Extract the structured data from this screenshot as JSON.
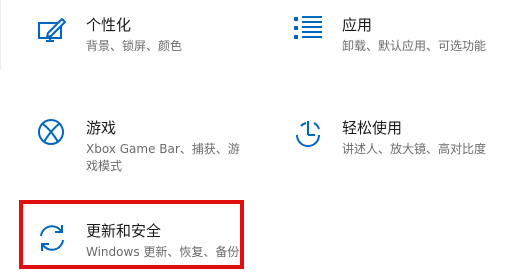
{
  "tiles": {
    "personalization": {
      "title": "个性化",
      "desc": "背景、锁屏、颜色",
      "icon": "personalization-icon"
    },
    "apps": {
      "title": "应用",
      "desc": "卸载、默认应用、可选功能",
      "icon": "apps-list-icon"
    },
    "gaming": {
      "title": "游戏",
      "desc_line1": "Xbox Game Bar、捕获、游",
      "desc_line2": "戏模式",
      "icon": "xbox-icon"
    },
    "ease_of_access": {
      "title": "轻松使用",
      "desc": "讲述人、放大镜、高对比度",
      "icon": "ease-of-access-icon"
    },
    "update_security": {
      "title": "更新和安全",
      "desc": "Windows 更新、恢复、备份",
      "icon": "sync-arrows-icon"
    }
  },
  "colors": {
    "accent": "#0067c0",
    "highlight": "#e01010",
    "text": "#1a1a1a",
    "secondary_text": "#6b6b6b"
  }
}
